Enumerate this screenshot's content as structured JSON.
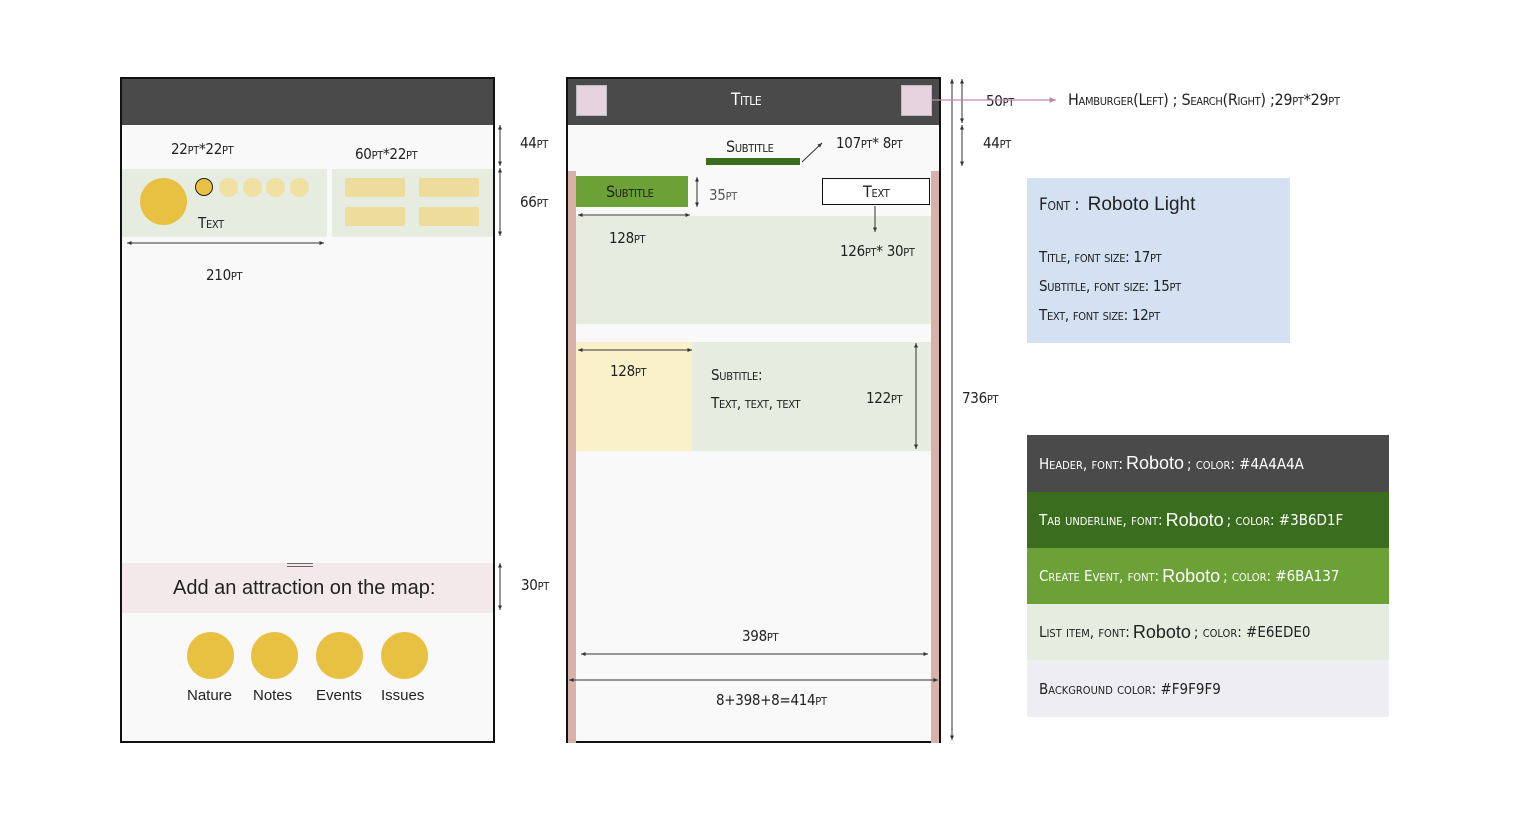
{
  "left_phone": {
    "measure_tab": "22pt*22pt",
    "measure_card": "60pt*22pt",
    "card_text": "Text",
    "width_label": "210pt",
    "header_height": "44pt",
    "list_height": "66pt",
    "sheet_height": "30pt",
    "sheet_title": "Add an attraction on the map:",
    "categories": [
      "Nature",
      "Notes",
      "Events",
      "Issues"
    ]
  },
  "right_phone": {
    "title": "Title",
    "subtitle": "Subtitle",
    "underline_measure": "107pt* 8pt",
    "create_button": "Subtitle",
    "create_height": "35pt",
    "text_box": "Text",
    "text_box_measure": "126pt* 30pt",
    "first_width": "128pt",
    "second_width": "128pt",
    "item_subtitle": "Subtitle:",
    "item_text": "Text, text, text",
    "item_height": "122pt",
    "content_width": "398pt",
    "total_width": "8+398+8=414pt",
    "header_height": "50pt",
    "subheader_height": "44pt",
    "screen_height": "736pt",
    "header_note": "Hamburger(Left) ; Search(Right) ;29pt*29pt"
  },
  "font_box": {
    "font_label": "Font :",
    "font_name": "Roboto Light",
    "lines": [
      "Title, font size: 17pt",
      "Subtitle, font size: 15pt",
      "Text, font size: 12pt"
    ]
  },
  "palette": [
    {
      "pre": "Header, font:",
      "font": "Roboto",
      "post": "; color: #4A4A4A",
      "bg": "#4a4a4a",
      "fg": "#ffffff"
    },
    {
      "pre": "Tab underline, font:",
      "font": "Roboto",
      "post": "; color: #3B6D1F",
      "bg": "#3b6d1f",
      "fg": "#ffffff"
    },
    {
      "pre": "Create Event, font:",
      "font": "Roboto",
      "post": "; color: #6BA137",
      "bg": "#6ba137",
      "fg": "#ffffff"
    },
    {
      "pre": "List item, font:",
      "font": "Roboto",
      "post": "; color: #E6EDE0",
      "bg": "#e6ede0",
      "fg": "#222222"
    },
    {
      "pre": "Background color: #F9F9F9",
      "font": "",
      "post": "",
      "bg": "#eeedf2",
      "fg": "#222222"
    }
  ]
}
